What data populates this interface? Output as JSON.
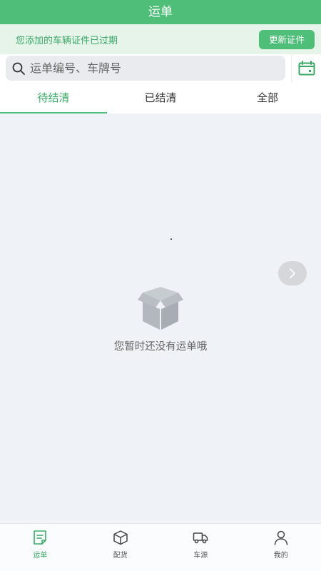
{
  "title": "运单",
  "notice": {
    "text": "您添加的车辆证件已过期",
    "button": "更新证件"
  },
  "search": {
    "placeholder": "运单编号、车牌号"
  },
  "tabs": [
    {
      "label": "待结清",
      "active": true
    },
    {
      "label": "已结清",
      "active": false
    },
    {
      "label": "全部",
      "active": false
    }
  ],
  "empty": {
    "text": "您暂时还没有运单哦"
  },
  "bottom_nav": [
    {
      "label": "运单",
      "icon": "waybill-icon",
      "active": true
    },
    {
      "label": "配货",
      "icon": "box-icon",
      "active": false
    },
    {
      "label": "车源",
      "icon": "truck-icon",
      "active": false
    },
    {
      "label": "我的",
      "icon": "user-icon",
      "active": false
    }
  ],
  "colors": {
    "primary": "#4fbe79",
    "primary_text": "#3aa866",
    "background": "#eff2f6"
  }
}
